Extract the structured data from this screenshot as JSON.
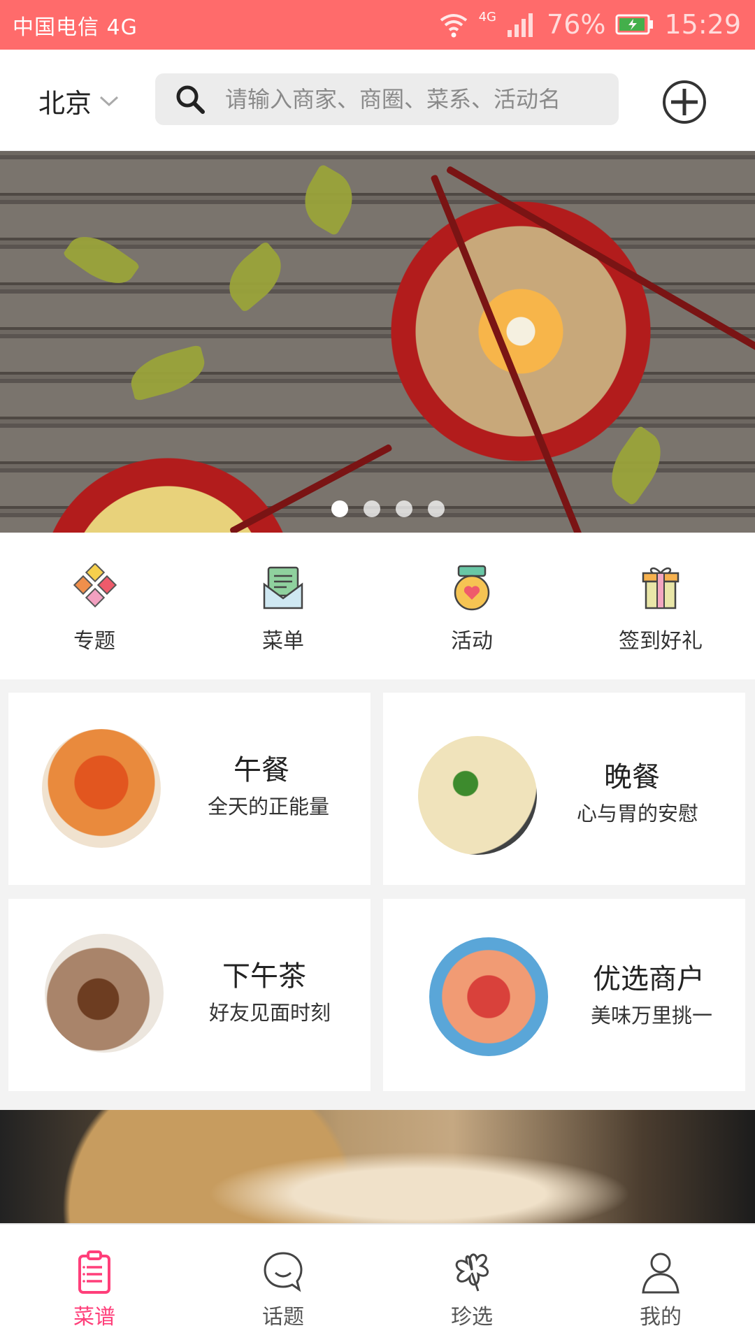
{
  "status_bar": {
    "carrier": "中国电信 4G",
    "network": "4G",
    "battery": "76%",
    "time": "15:29"
  },
  "header": {
    "city": "北京",
    "search_placeholder": "请输入商家、商圈、菜系、活动名",
    "add_icon": "plus-circle-icon"
  },
  "banner": {
    "dots": 4,
    "active_index": 0
  },
  "quick_nav": [
    {
      "label": "专题",
      "icon": "diamond-grid-icon"
    },
    {
      "label": "菜单",
      "icon": "envelope-menu-icon"
    },
    {
      "label": "活动",
      "icon": "medal-icon"
    },
    {
      "label": "签到好礼",
      "icon": "gift-box-icon"
    }
  ],
  "cards": [
    {
      "title": "午餐",
      "subtitle": "全天的正能量"
    },
    {
      "title": "晚餐",
      "subtitle": "心与胃的安慰"
    },
    {
      "title": "下午茶",
      "subtitle": "好友见面时刻"
    },
    {
      "title": "优选商户",
      "subtitle": "美味万里挑一"
    }
  ],
  "tabbar": [
    {
      "label": "菜谱",
      "icon": "recipe-list-icon",
      "active": true
    },
    {
      "label": "话题",
      "icon": "chat-bubble-icon",
      "active": false
    },
    {
      "label": "珍选",
      "icon": "clover-icon",
      "active": false
    },
    {
      "label": "我的",
      "icon": "user-icon",
      "active": false
    }
  ],
  "colors": {
    "status_bar": "#ff6b6b",
    "active_tab": "#ff3f7a"
  }
}
